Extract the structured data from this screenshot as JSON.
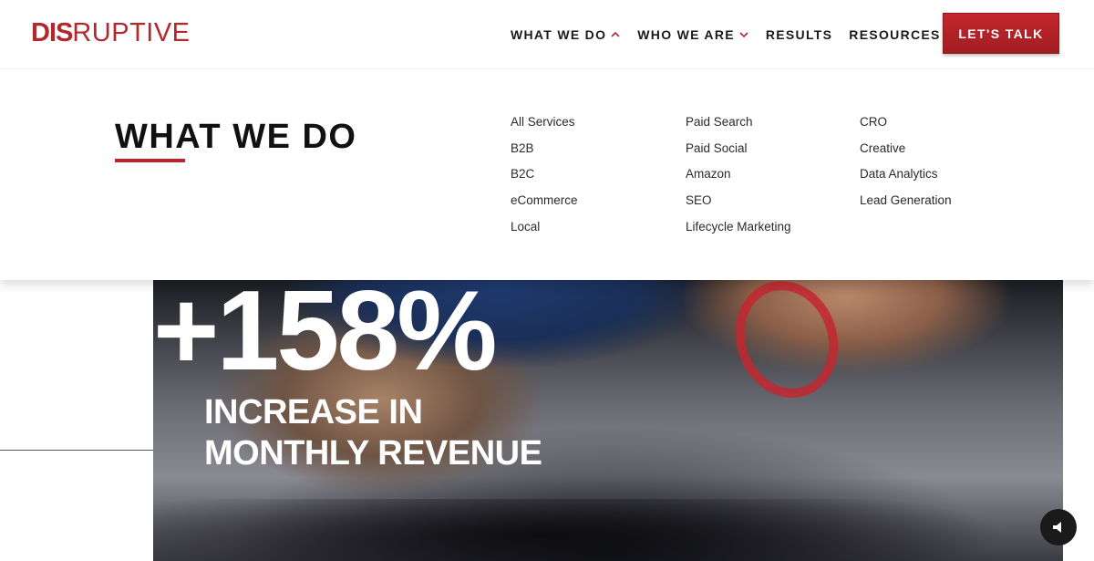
{
  "brand": {
    "logo_bold": "DIS",
    "logo_thin": "RUPTIVE",
    "accent_color": "#b3282d"
  },
  "nav": {
    "items": [
      {
        "label": "WHAT WE DO",
        "chevron": "up"
      },
      {
        "label": "WHO WE ARE",
        "chevron": "down"
      },
      {
        "label": "RESULTS",
        "chevron": "none"
      },
      {
        "label": "RESOURCES",
        "chevron": "down"
      }
    ],
    "cta_label": "LET'S TALK"
  },
  "mega_menu": {
    "title": "WHAT WE DO",
    "columns": [
      [
        "All Services",
        "B2B",
        "B2C",
        "eCommerce",
        "Local"
      ],
      [
        "Paid Search",
        "Paid Social",
        "Amazon",
        "SEO",
        "Lifecycle Marketing"
      ],
      [
        "CRO",
        "Creative",
        "Data Analytics",
        "Lead Generation"
      ]
    ]
  },
  "hero": {
    "stat_value": "+158%",
    "stat_line1": "INCREASE IN",
    "stat_line2": "MONTHLY REVENUE",
    "sound_icon": "speaker-icon"
  }
}
